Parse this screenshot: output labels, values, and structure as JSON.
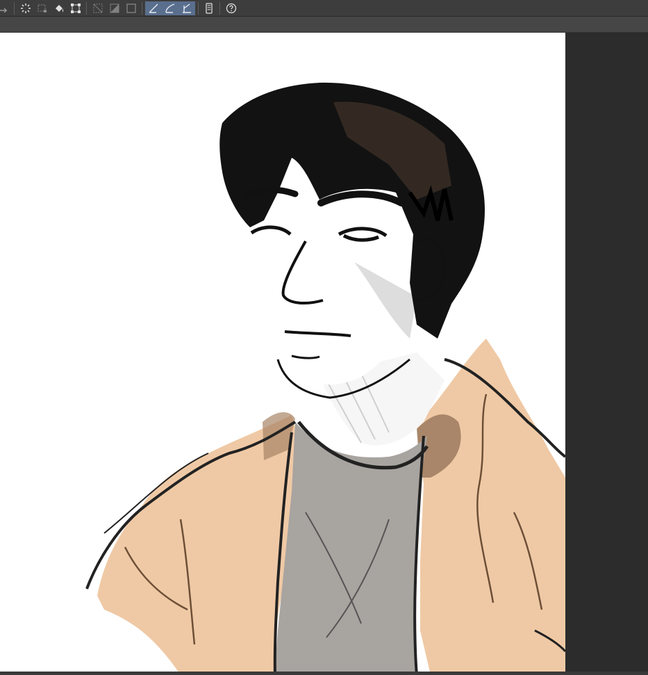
{
  "toolbar": {
    "buttons": [
      {
        "icon": "redo-icon"
      },
      {
        "icon": "loading-icon"
      },
      {
        "icon": "selection-icon"
      },
      {
        "icon": "fill-icon"
      },
      {
        "icon": "transform-icon"
      },
      {
        "icon": "clear-selection-icon"
      },
      {
        "icon": "invert-selection-icon"
      },
      {
        "icon": "selection-border-icon"
      },
      {
        "icon": "ruler-straight-icon",
        "active": true
      },
      {
        "icon": "ruler-curve-icon",
        "active": true
      },
      {
        "icon": "ruler-angle-icon",
        "active": true
      },
      {
        "icon": "smartphone-icon"
      },
      {
        "icon": "help-icon"
      }
    ]
  },
  "colors": {
    "toolbar_bg": "#3d3d3d",
    "subbar_bg": "#464646",
    "canvas_bg": "#ffffff",
    "workspace_bg": "#2b2b2b",
    "active_tool": "#5a6f8e",
    "hair": "#111111",
    "jacket": "#efc9a5",
    "shirt": "#a8a4a0"
  }
}
